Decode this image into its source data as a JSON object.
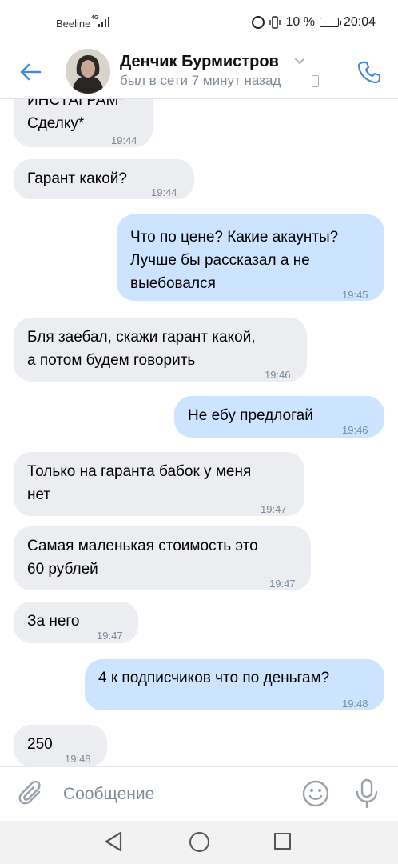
{
  "status_bar": {
    "carrier": "Beeline",
    "network": "4G",
    "battery": "10 %",
    "time": "20:04"
  },
  "header": {
    "contact_name": "Денчик Бурмистров",
    "last_seen": "был в сети 7 минут назад",
    "icons": {
      "back": "arrow-left-icon",
      "call": "phone-icon",
      "expand": "chevron-down-icon",
      "device": "mobile-device-icon"
    }
  },
  "messages": [
    {
      "direction": "in",
      "text": "ИНСТАГРАМ*\nСделку*",
      "time": "19:44"
    },
    {
      "direction": "in",
      "text": "Гарант какой?",
      "time": "19:44"
    },
    {
      "direction": "out",
      "text": "Что по цене? Какие акаунты?\nЛучше бы рассказал а не\nвыебовался",
      "time": "19:45"
    },
    {
      "direction": "in",
      "text": "Бля заебал, скажи гарант какой,\nа потом будем говорить",
      "time": "19:46"
    },
    {
      "direction": "out",
      "text": "Не ебу предлогай",
      "time": "19:46"
    },
    {
      "direction": "in",
      "text": "Только на гаранта бабок у меня\nнет",
      "time": "19:47"
    },
    {
      "direction": "in",
      "text": "Самая маленькая стоимость это\n60 рублей",
      "time": "19:47"
    },
    {
      "direction": "in",
      "text": "За него",
      "time": "19:47"
    },
    {
      "direction": "out",
      "text": "4 к подписчиков что по деньгам?",
      "time": "19:48"
    },
    {
      "direction": "in",
      "text": "250",
      "time": "19:48"
    }
  ],
  "composer": {
    "placeholder": "Сообщение",
    "icons": {
      "attach": "paperclip-icon",
      "emoji": "smiley-icon",
      "voice": "microphone-icon"
    }
  },
  "navbar": {
    "icons": {
      "back": "triangle-back-icon",
      "home": "circle-home-icon",
      "recents": "square-recents-icon"
    }
  },
  "colors": {
    "accent": "#3f8ae0",
    "incoming_bubble": "#ebedf0",
    "outgoing_bubble": "#cce4ff",
    "secondary_text": "#818c99"
  }
}
